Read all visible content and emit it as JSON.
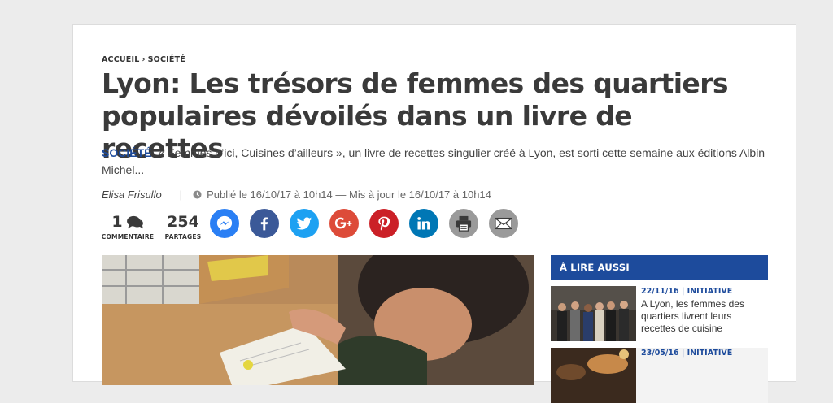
{
  "breadcrumb": {
    "home": "ACCUEIL",
    "separator": "›",
    "section": "SOCIÉTÉ"
  },
  "article": {
    "title": "Lyon: Les trésors de femmes des quartiers populaires dévoilés dans un livre de recettes",
    "category": "SOCIÉTÉ",
    "lead": "« Femmes d’ici, Cuisines d’ailleurs », un livre de recettes singulier créé à Lyon, est sorti cette semaine aux éditions Albin Michel...",
    "author": "Elisa Frisullo",
    "separator": "|",
    "published": "Publié le 16/10/17 à 10h14 — Mis à jour le 16/10/17 à 10h14"
  },
  "counts": {
    "comments_value": "1",
    "comments_label": "COMMENTAIRE",
    "shares_value": "254",
    "shares_label": "PARTAGES"
  },
  "share_buttons": [
    {
      "name": "messenger",
      "color": "#2a7ff4"
    },
    {
      "name": "facebook",
      "color": "#3b5998"
    },
    {
      "name": "twitter",
      "color": "#1da1f2"
    },
    {
      "name": "google-plus",
      "color": "#dd4b39"
    },
    {
      "name": "pinterest",
      "color": "#cb2027"
    },
    {
      "name": "linkedin",
      "color": "#0077b5"
    },
    {
      "name": "print",
      "color": "#9a9a9a"
    },
    {
      "name": "email",
      "color": "#9a9a9a"
    }
  ],
  "aside": {
    "heading": "À LIRE AUSSI",
    "items": [
      {
        "date": "22/11/16 | INITIATIVE",
        "title": "A Lyon, les femmes des quartiers livrent leurs recettes de cuisine"
      },
      {
        "date": "23/05/16 | INITIATIVE",
        "title": ""
      }
    ]
  },
  "colors": {
    "accent": "#1d4b9c",
    "text": "#3a3a3a",
    "background": "#ececec"
  }
}
